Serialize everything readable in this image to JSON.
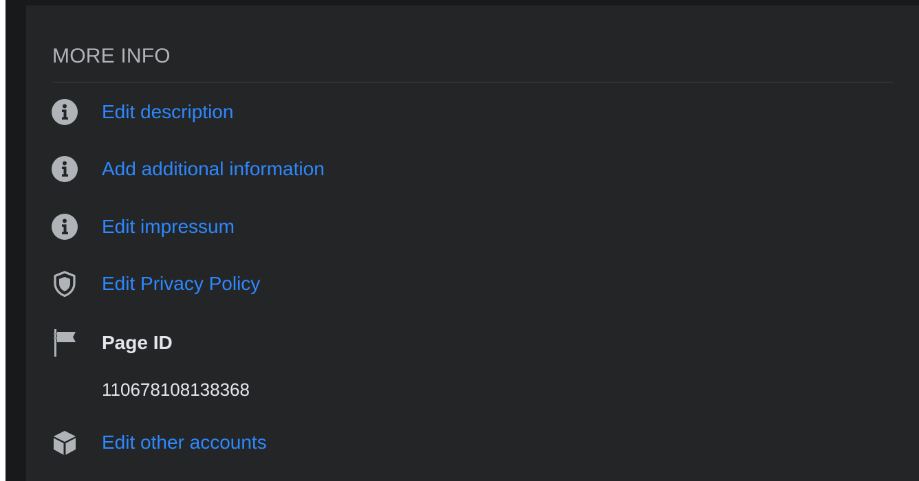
{
  "section": {
    "title": "MORE INFO"
  },
  "rows": [
    {
      "label": "Edit description",
      "icon": "info-icon"
    },
    {
      "label": "Add additional information",
      "icon": "info-icon"
    },
    {
      "label": "Edit impressum",
      "icon": "info-icon"
    },
    {
      "label": "Edit Privacy Policy",
      "icon": "shield-icon"
    },
    {
      "label": "Page ID",
      "icon": "flag-icon"
    },
    {
      "label": "Edit other accounts",
      "icon": "cube-icon"
    }
  ],
  "page_id": {
    "value": "110678108138368"
  },
  "colors": {
    "link": "#2d88ff",
    "text_primary": "#e4e6eb",
    "text_secondary": "#b0b3b8",
    "icon": "#b0b3b8",
    "card_background": "#242526",
    "page_background": "#18191a"
  }
}
